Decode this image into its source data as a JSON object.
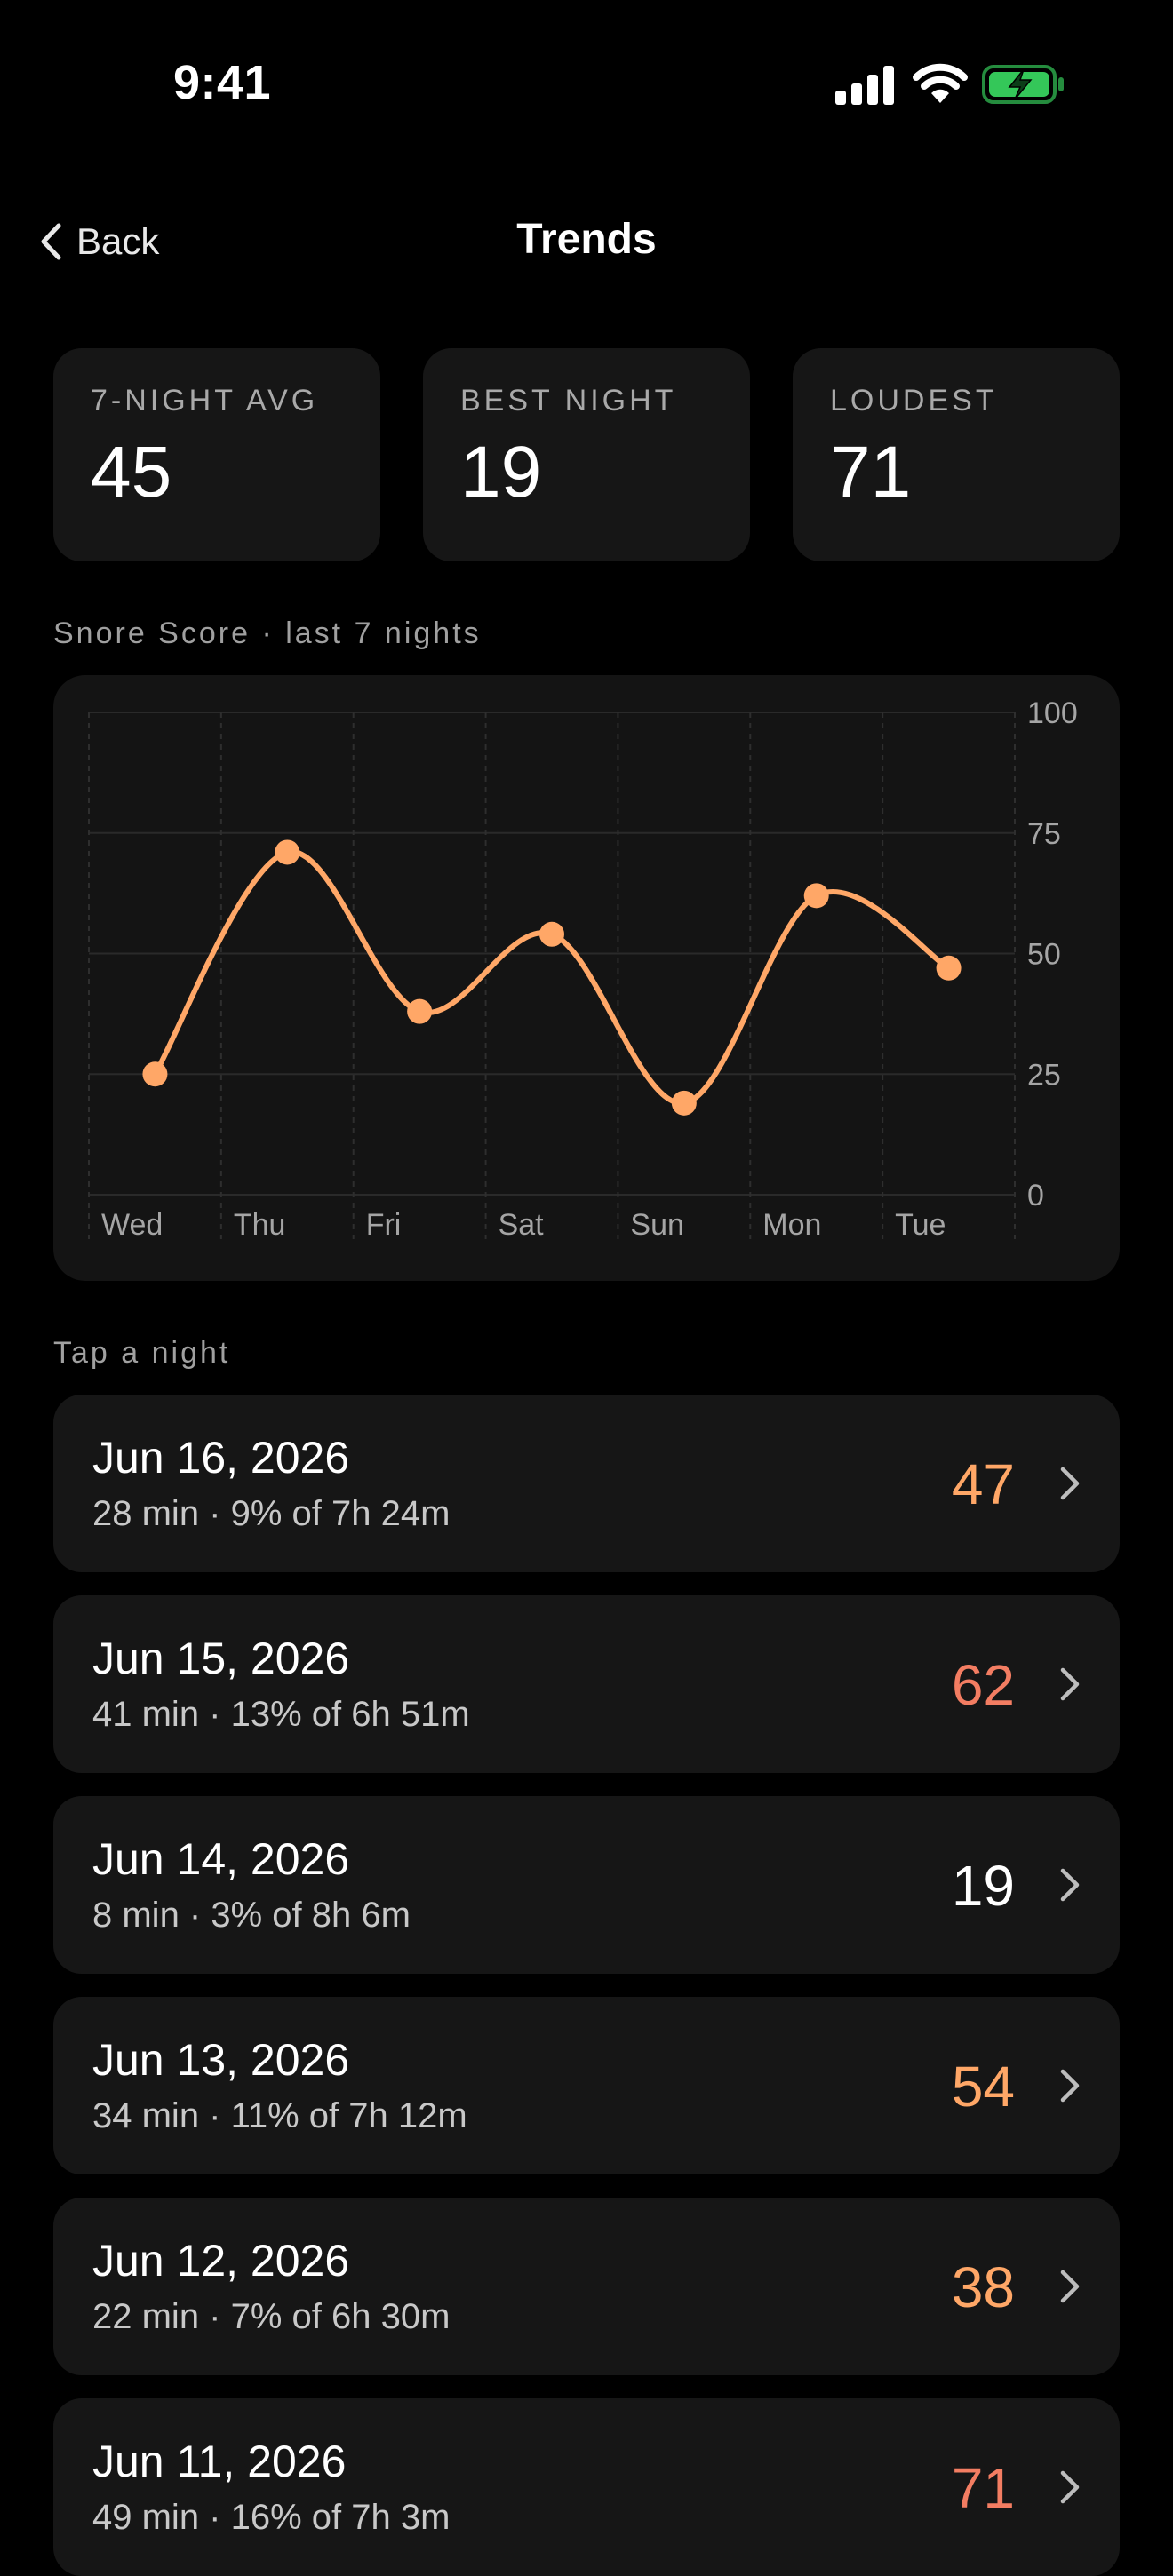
{
  "status": {
    "time": "9:41",
    "icons": [
      "cellular-signal-icon",
      "wifi-icon",
      "battery-charging-icon"
    ]
  },
  "nav": {
    "back_label": "Back",
    "title": "Trends"
  },
  "stats": [
    {
      "label": "7-NIGHT AVG",
      "value": "45"
    },
    {
      "label": "BEST NIGHT",
      "value": "19"
    },
    {
      "label": "LOUDEST",
      "value": "71"
    }
  ],
  "chart_section_label": "Snore Score · last 7 nights",
  "list_section_label": "Tap a night",
  "colors": {
    "accent": "#FFA767",
    "high": "#F37D62",
    "neutral": "#FFFFFF",
    "battery": "#34C759"
  },
  "chart_data": {
    "type": "line",
    "categories": [
      "Wed",
      "Thu",
      "Fri",
      "Sat",
      "Sun",
      "Mon",
      "Tue"
    ],
    "series": [
      {
        "values": [
          25,
          71,
          38,
          54,
          19,
          62,
          47
        ]
      }
    ],
    "ylim": [
      0,
      100
    ],
    "yticks": [
      "0",
      "25",
      "50",
      "75",
      "100"
    ],
    "grid": true,
    "y_axis_side": "right"
  },
  "nights": [
    {
      "date": "Jun 16, 2026",
      "detail": "28 min · 9% of 7h 24m",
      "score": "47",
      "score_color": "#FFA767"
    },
    {
      "date": "Jun 15, 2026",
      "detail": "41 min · 13% of 6h 51m",
      "score": "62",
      "score_color": "#F37D62"
    },
    {
      "date": "Jun 14, 2026",
      "detail": "8 min · 3% of 8h 6m",
      "score": "19",
      "score_color": "#FFFFFF"
    },
    {
      "date": "Jun 13, 2026",
      "detail": "34 min · 11% of 7h 12m",
      "score": "54",
      "score_color": "#FFA767"
    },
    {
      "date": "Jun 12, 2026",
      "detail": "22 min · 7% of 6h 30m",
      "score": "38",
      "score_color": "#FFA767"
    },
    {
      "date": "Jun 11, 2026",
      "detail": "49 min · 16% of 7h 3m",
      "score": "71",
      "score_color": "#F37D62"
    }
  ]
}
